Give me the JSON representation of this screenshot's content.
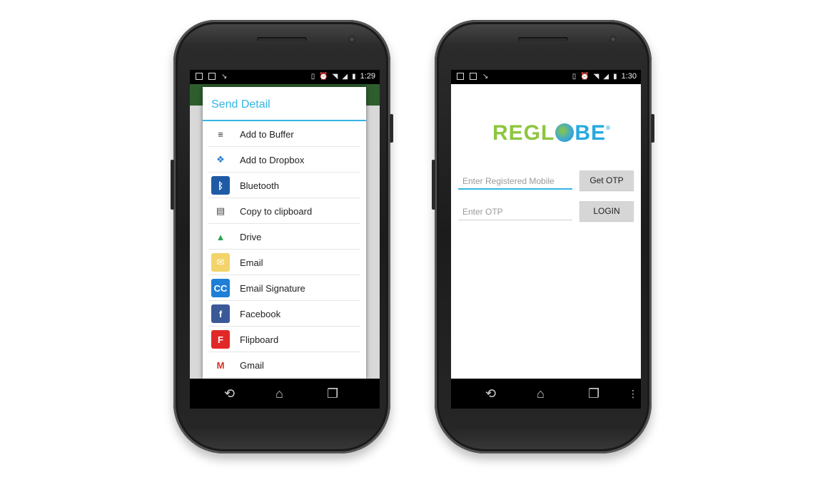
{
  "left_phone": {
    "status": {
      "time": "1:29"
    },
    "dialog": {
      "title": "Send Detail",
      "items": [
        {
          "label": "Add to Buffer",
          "icon": "buffer-icon",
          "color": "#ffffff",
          "fg": "#333333",
          "glyph": "≡"
        },
        {
          "label": "Add to Dropbox",
          "icon": "dropbox-icon",
          "color": "#ffffff",
          "fg": "#2a7fd4",
          "glyph": "❖"
        },
        {
          "label": "Bluetooth",
          "icon": "bluetooth-icon",
          "color": "#1f5aa6",
          "fg": "#ffffff",
          "glyph": "ᛒ"
        },
        {
          "label": "Copy to clipboard",
          "icon": "clipboard-icon",
          "color": "#ffffff",
          "fg": "#444444",
          "glyph": "▤"
        },
        {
          "label": "Drive",
          "icon": "drive-icon",
          "color": "#ffffff",
          "fg": "#2da44e",
          "glyph": "▲"
        },
        {
          "label": "Email",
          "icon": "email-icon",
          "color": "#f2d46b",
          "fg": "#ffffff",
          "glyph": "✉"
        },
        {
          "label": "Email Signature",
          "icon": "email-signature-icon",
          "color": "#1e7fd6",
          "fg": "#ffffff",
          "glyph": "CC"
        },
        {
          "label": "Facebook",
          "icon": "facebook-icon",
          "color": "#3b5998",
          "fg": "#ffffff",
          "glyph": "f"
        },
        {
          "label": "Flipboard",
          "icon": "flipboard-icon",
          "color": "#e12828",
          "fg": "#ffffff",
          "glyph": "F"
        },
        {
          "label": "Gmail",
          "icon": "gmail-icon",
          "color": "#ffffff",
          "fg": "#d93025",
          "glyph": "M"
        }
      ]
    }
  },
  "right_phone": {
    "status": {
      "time": "1:30"
    },
    "logo": {
      "part1": "REGL",
      "part2": "BE",
      "reg": "®"
    },
    "mobile_field": {
      "placeholder": "Enter Registered Mobile"
    },
    "otp_field": {
      "placeholder": "Enter OTP"
    },
    "get_otp_label": "Get OTP",
    "login_label": "LOGIN"
  },
  "colors": {
    "accent": "#33b5e5",
    "logo_green": "#8dc63f",
    "logo_blue": "#27a9e1"
  }
}
